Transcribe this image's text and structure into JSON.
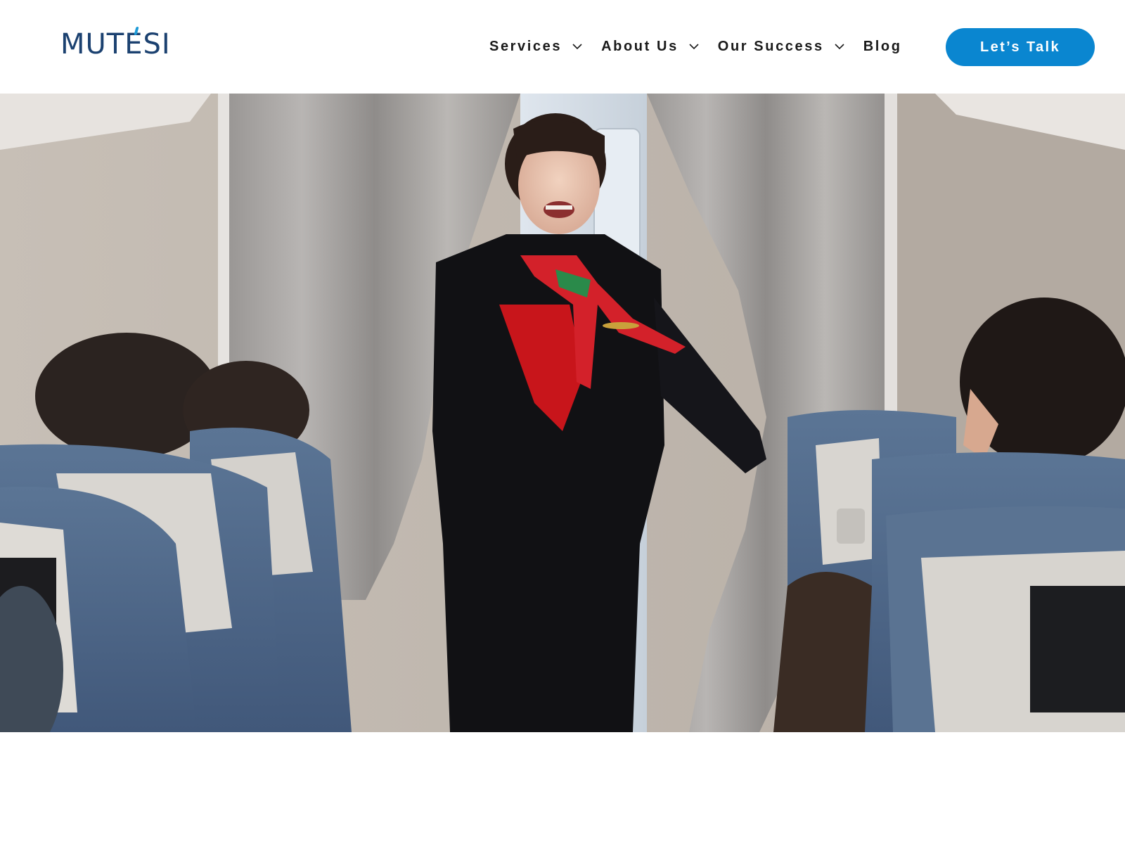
{
  "brand": {
    "logo_text": "MUTESI",
    "accent_color": "#1e9bd7",
    "logo_color": "#1b4170"
  },
  "nav": {
    "items": [
      {
        "label": "Services",
        "has_dropdown": true
      },
      {
        "label": "About Us",
        "has_dropdown": true
      },
      {
        "label": "Our Success",
        "has_dropdown": true
      },
      {
        "label": "Blog",
        "has_dropdown": false
      }
    ],
    "cta_label": "Let’s Talk",
    "cta_color": "#0a86d0"
  },
  "hero": {
    "image": "flight-attendant-in-aircraft-cabin-aisle"
  }
}
